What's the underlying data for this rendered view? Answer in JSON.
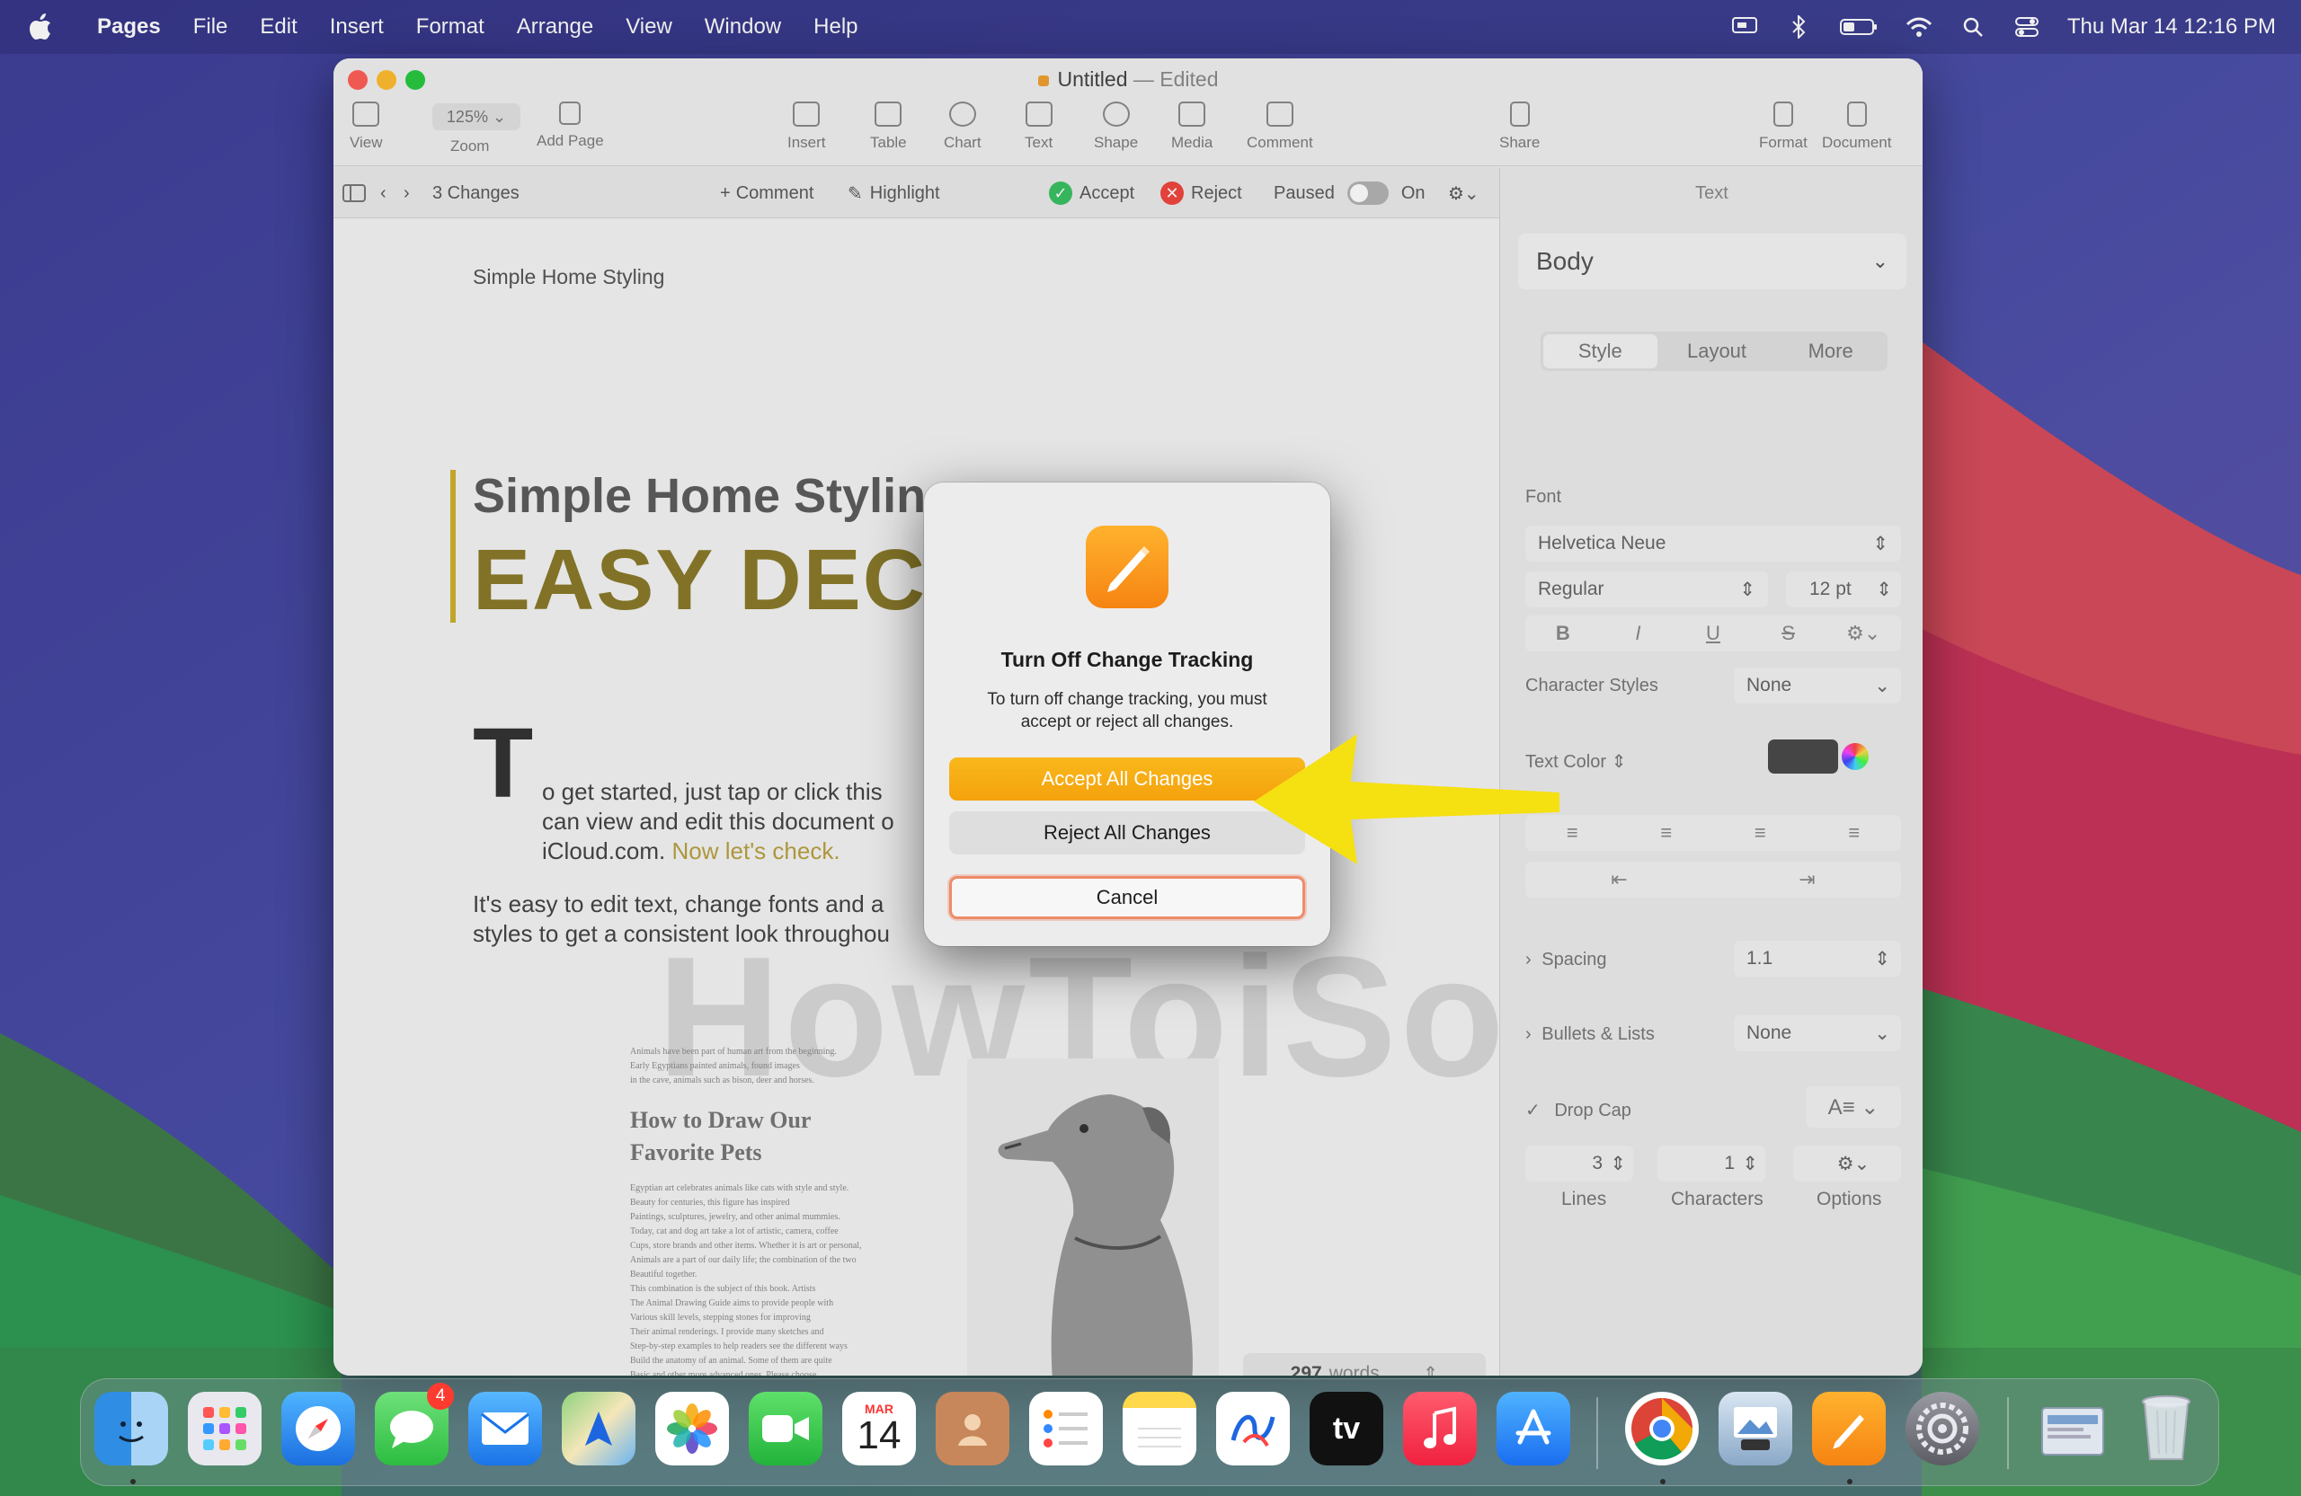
{
  "menubar": {
    "app": "Pages",
    "items": [
      "File",
      "Edit",
      "Insert",
      "Format",
      "Arrange",
      "View",
      "Window",
      "Help"
    ],
    "clock": "Thu Mar 14  12:16 PM"
  },
  "window": {
    "title": "Untitled",
    "status": "— Edited",
    "toolbar": {
      "zoom": "125%",
      "buttons": [
        "View",
        "Zoom",
        "Add Page",
        "Insert",
        "Table",
        "Chart",
        "Text",
        "Shape",
        "Media",
        "Comment",
        "Share",
        "Format",
        "Document"
      ]
    },
    "trackbar": {
      "changes": "3 Changes",
      "comment": "Comment",
      "highlight": "Highlight",
      "accept": "Accept",
      "reject": "Reject",
      "paused": "Paused",
      "on": "On"
    }
  },
  "document": {
    "header": "Simple Home Styling",
    "heading": "Simple Home Styling",
    "subheading": "EASY DECO",
    "dropcap": "T",
    "para1": [
      "o get started, just tap or click this",
      "can view and edit this document o",
      "iCloud.com."
    ],
    "para1_link": "Now let's check.",
    "para2": [
      "It's easy to edit text, change fonts and a",
      "styles to get a consistent look throughou"
    ],
    "article_intro": [
      "Animals have been part of human art from the beginning.",
      "Early Egyptians painted animals, found images",
      "in the cave, animals such as bison, deer and horses."
    ],
    "article_title": "How to Draw Our Favorite Pets",
    "article_body": [
      "Egyptian art celebrates animals like cats with style and style.",
      "Beauty for centuries, this figure has inspired",
      "Paintings, sculptures, jewelry, and other animal mummies.",
      "Today, cat and dog art take a lot of artistic, camera, coffee",
      "Cups, store brands and other items. Whether it is art or personal,",
      "Animals are a part of our daily life; the combination of the two",
      "Beautiful together.",
      "This combination is the subject of this book. Artists",
      "The Animal Drawing Guide aims to provide people with",
      "Various skill levels, stepping stones for improving",
      "Their animal renderings. I provide many sketches and",
      "Step-by-step examples to help readers see the different ways",
      "Build the anatomy of an animal. Some of them are quite",
      "Basic and other more advanced ones. Please choose"
    ],
    "word_count": "297",
    "word_unit": "words",
    "watermark": "HowToiSolve.com"
  },
  "inspector": {
    "title": "Text",
    "paragraph_style": "Body",
    "tabs": [
      "Style",
      "Layout",
      "More"
    ],
    "active_tab": "Style",
    "font_label": "Font",
    "font_family": "Helvetica Neue",
    "font_weight": "Regular",
    "font_size": "12 pt",
    "format_buttons": [
      "B",
      "I",
      "U",
      "S"
    ],
    "character_styles_label": "Character Styles",
    "character_styles_value": "None",
    "text_color_label": "Text Color",
    "spacing_label": "Spacing",
    "spacing_value": "1.1",
    "bullets_label": "Bullets & Lists",
    "bullets_value": "None",
    "drop_cap_label": "Drop Cap",
    "drop_cap_checked": true,
    "lines_value": "3",
    "lines_label": "Lines",
    "characters_value": "1",
    "characters_label": "Characters",
    "options_label": "Options"
  },
  "dialog": {
    "title": "Turn Off Change Tracking",
    "message": "To turn off change tracking, you must accept or reject all changes.",
    "accept_button": "Accept All Changes",
    "reject_button": "Reject All Changes",
    "cancel_button": "Cancel"
  },
  "dock": {
    "apps": [
      "Finder",
      "Launchpad",
      "Safari",
      "Messages",
      "Mail",
      "Maps",
      "Photos",
      "FaceTime",
      "Calendar",
      "Contacts",
      "Reminders",
      "Notes",
      "Freeform",
      "TV",
      "Music",
      "App Store",
      "Chrome",
      "Preview",
      "Pages",
      "System Settings",
      "Downloads",
      "Trash"
    ],
    "messages_badge": "4",
    "calendar_month": "MAR",
    "calendar_day": "14"
  },
  "colors": {
    "accent_orange": "#f5a20d",
    "annotation_arrow": "#f5e012",
    "cancel_focus_ring": "#ee8b6a"
  }
}
